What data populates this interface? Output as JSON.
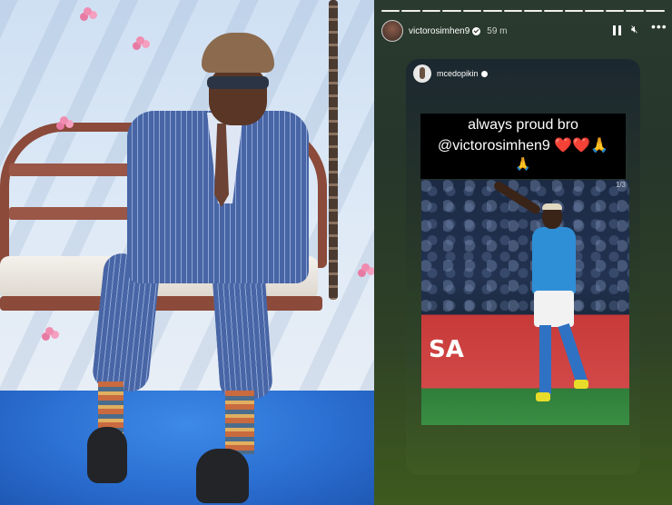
{
  "left_photo": {
    "description_hidden": ""
  },
  "story": {
    "progress_segments": 14,
    "username": "victorosimhen9",
    "time": "59 m",
    "icons": {
      "pause": "pause-icon",
      "mute": "mute-icon",
      "more": "more-icon"
    },
    "repost": {
      "username": "mcedopikin",
      "caption_line1": "always proud bro",
      "caption_line2": "@victorosimhen9",
      "caption_hearts": "❤️❤️🙏",
      "caption_line3": "🙏",
      "page_indicator": "1/3",
      "board_text": "SA"
    },
    "colors": {
      "accent_heart": "#e02525",
      "story_bg": "#2a3a2e"
    }
  }
}
